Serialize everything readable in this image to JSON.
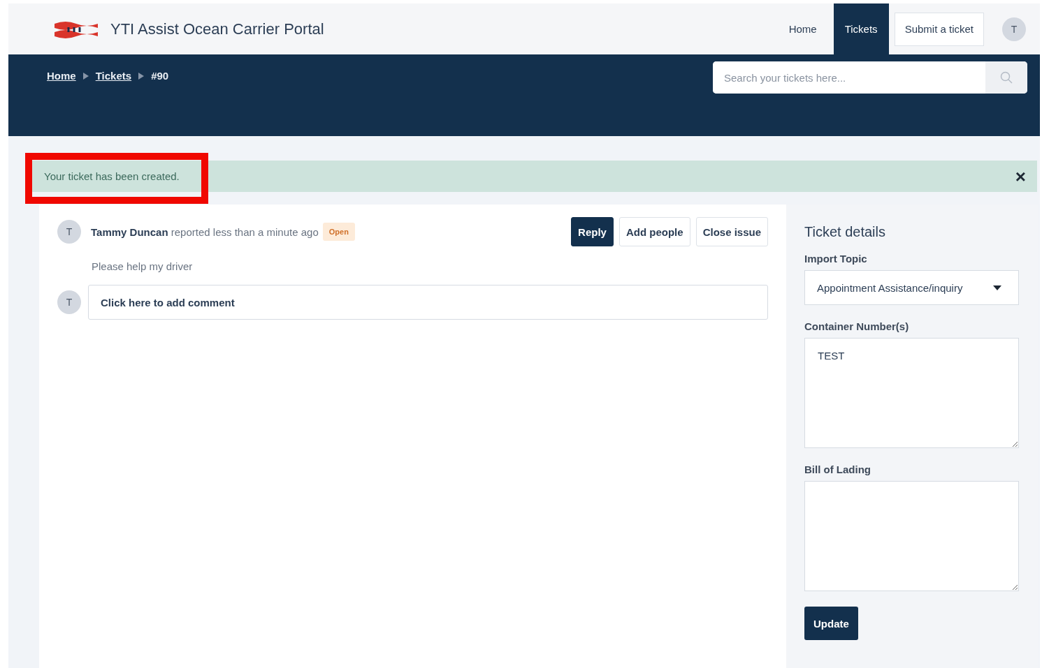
{
  "header": {
    "brand": "YTI Assist Ocean Carrier Portal",
    "nav": [
      {
        "label": "Home",
        "kind": "link",
        "selected": false
      },
      {
        "label": "Tickets",
        "kind": "link",
        "selected": true
      },
      {
        "label": "Submit a ticket",
        "kind": "button",
        "selected": false
      }
    ],
    "avatar": "T"
  },
  "breadcrumbs": [
    {
      "label": "Home",
      "link": true
    },
    {
      "label": "Tickets",
      "link": true
    },
    {
      "label": "#90",
      "link": false
    }
  ],
  "search": {
    "placeholder": "Search your tickets here..."
  },
  "alert": {
    "message": "Your ticket has been created.",
    "highlighted": true,
    "close": "×"
  },
  "ticket": {
    "avatar": "T",
    "author": "Tammy Duncan",
    "action": "reported less than a minute ago",
    "status": "Open",
    "actions": [
      {
        "label": "Reply",
        "primary": true
      },
      {
        "label": "Add people",
        "primary": false
      },
      {
        "label": "Close issue",
        "primary": false
      }
    ],
    "body": "Please help my driver",
    "comment": {
      "avatar": "T",
      "placeholder": "Click here to add comment"
    }
  },
  "details": {
    "title": "Ticket details",
    "fields": [
      {
        "kind": "select",
        "label": "Import Topic",
        "value": "Appointment Assistance/inquiry"
      },
      {
        "kind": "textarea",
        "label": "Container Number(s)",
        "value": "TEST"
      },
      {
        "kind": "textarea",
        "label": "Bill of Lading"
      }
    ],
    "submit": "Update"
  }
}
